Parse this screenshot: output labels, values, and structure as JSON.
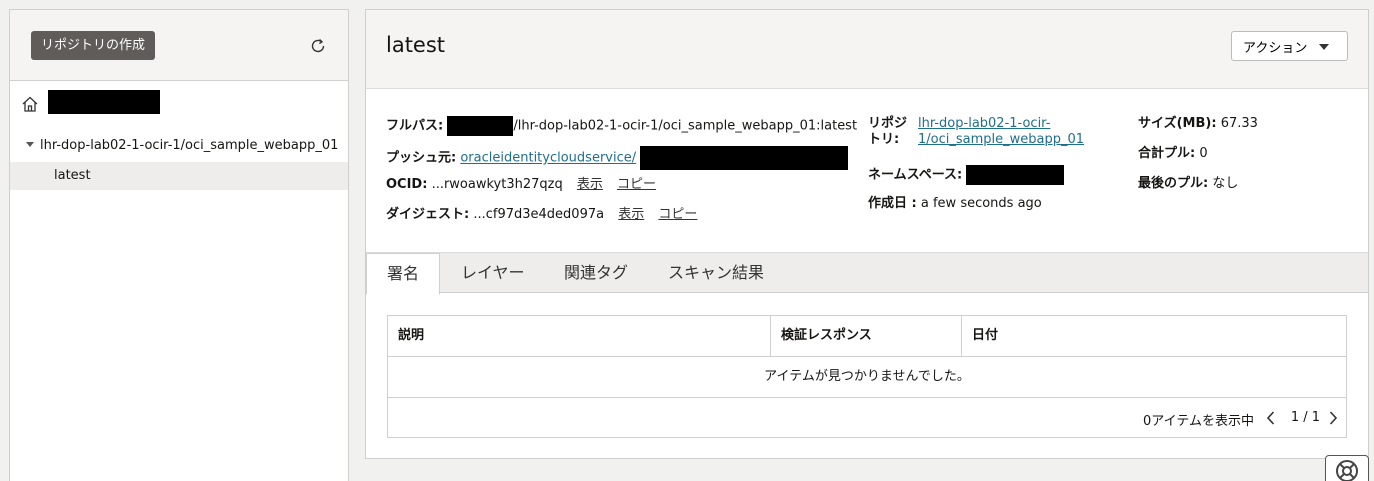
{
  "sidebar": {
    "create_button": "リポジトリの作成",
    "tree_repo": "lhr-dop-lab02-1-ocir-1/oci_sample_webapp_01",
    "tree_child": "latest"
  },
  "main": {
    "title": "latest",
    "action_button": "アクション",
    "info": {
      "fullpath_label": "フルパス:",
      "fullpath_value": "/lhr-dop-lab02-1-ocir-1/oci_sample_webapp_01:latest",
      "push_label": "プッシュ元:",
      "push_value": "oracleidentitycloudservice/",
      "ocid_label": "OCID:",
      "ocid_value": "...rwoawkyt3h27qzq",
      "digest_label": "ダイジェスト:",
      "digest_value": "...cf97d3e4ded097a",
      "show": "表示",
      "copy": "コピー",
      "repo_label_1": "リポジ",
      "repo_label_2": "トリ:",
      "repo_value_1": "lhr-dop-lab02-1-ocir-",
      "repo_value_2": "1/oci_sample_webapp_01",
      "namespace_label": "ネームスペース:",
      "created_label": "作成日 :",
      "created_value": "a few seconds ago",
      "size_label": "サイズ(MB):",
      "size_value": "67.33",
      "pulls_label": "合計プル:",
      "pulls_value": "0",
      "lastpull_label": "最後のプル:",
      "lastpull_value": "なし"
    },
    "tabs": [
      "署名",
      "レイヤー",
      "関連タグ",
      "スキャン結果"
    ],
    "table": {
      "columns": [
        "説明",
        "検証レスポンス",
        "日付"
      ],
      "empty_message": "アイテムが見つかりませんでした。",
      "count_text": "0アイテムを表示中",
      "pages": "1 / 1"
    }
  }
}
